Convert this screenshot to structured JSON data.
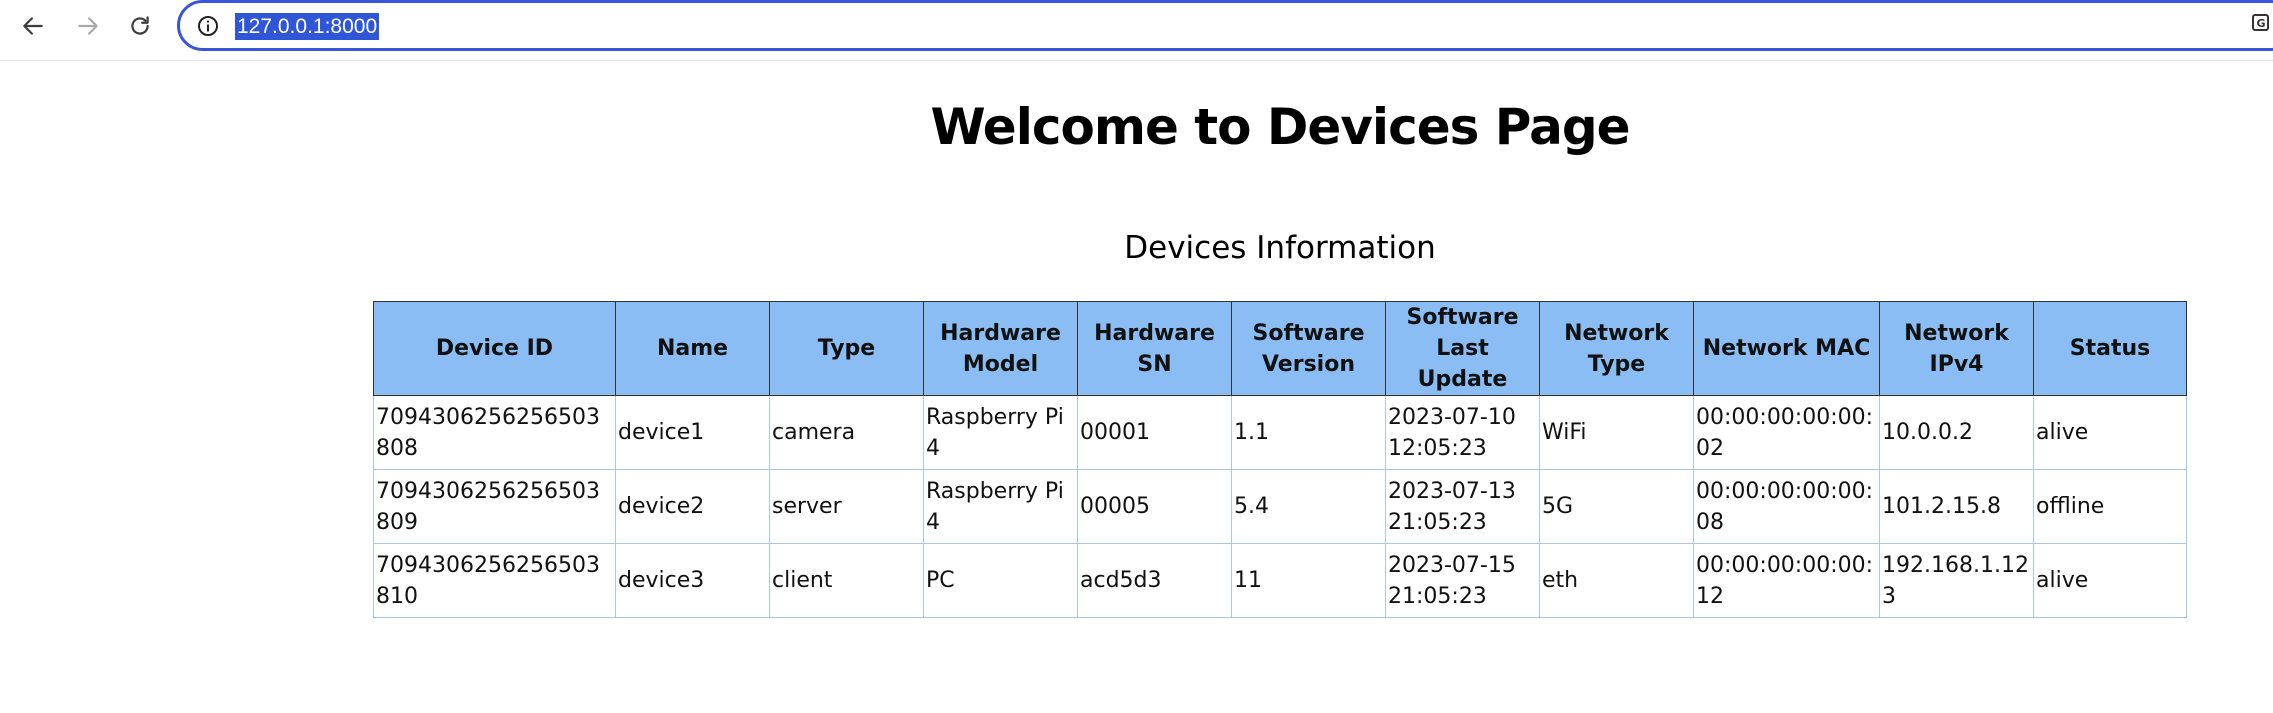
{
  "browser": {
    "url": "127.0.0.1:8000"
  },
  "page": {
    "title": "Welcome to Devices Page",
    "section_title": "Devices Information"
  },
  "table": {
    "headers": [
      "Device ID",
      "Name",
      "Type",
      "Hardware Model",
      "Hardware SN",
      "Software Version",
      "Software Last Update",
      "Network Type",
      "Network MAC",
      "Network IPv4",
      "Status"
    ],
    "rows": [
      [
        "7094306256256503808",
        "device1",
        "camera",
        "Raspberry Pi 4",
        "00001",
        "1.1",
        "2023-07-10 12:05:23",
        "WiFi",
        "00:00:00:00:00:02",
        "10.0.0.2",
        "alive"
      ],
      [
        "7094306256256503809",
        "device2",
        "server",
        "Raspberry Pi 4",
        "00005",
        "5.4",
        "2023-07-13 21:05:23",
        "5G",
        "00:00:00:00:00:08",
        "101.2.15.8",
        "offline"
      ],
      [
        "7094306256256503810",
        "device3",
        "client",
        "PC",
        "acd5d3",
        "11",
        "2023-07-15 21:05:23",
        "eth",
        "00:00:00:00:00:12",
        "192.168.1.123",
        "alive"
      ]
    ]
  },
  "colors": {
    "header_bg": "#89bdf4",
    "omnibox_border": "#3a56d8",
    "url_highlight": "#2f56d6"
  },
  "icons": {
    "back": "arrow-left-icon",
    "forward": "arrow-right-icon",
    "reload": "reload-icon",
    "site_info": "info-icon",
    "translate": "translate-icon"
  }
}
